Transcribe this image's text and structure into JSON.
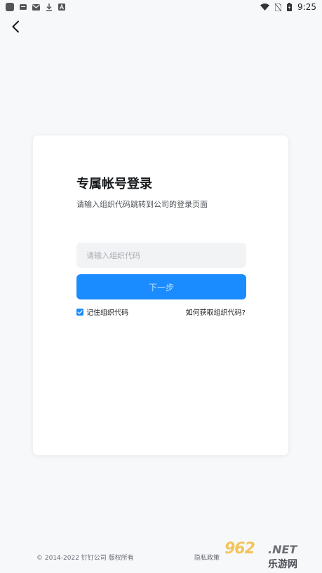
{
  "status_bar": {
    "time": "9:25"
  },
  "login": {
    "title": "专属帐号登录",
    "subtitle": "请输入组织代码跳转到公司的登录页面",
    "org_code_placeholder": "请输入组织代码",
    "org_code_value": "",
    "next_label": "下一步",
    "remember_label": "记住组织代码",
    "remember_checked": true,
    "how_to_label": "如何获取组织代码?"
  },
  "footer": {
    "copyright": "© 2014-2022 钉钉公司 版权所有",
    "privacy_label": "隐私政策"
  },
  "watermark": {
    "number": "962",
    "domain": ".NET",
    "name": "乐游网"
  },
  "colors": {
    "accent": "#1a8cff",
    "background": "#f7f8fa",
    "card": "#ffffff",
    "input_bg": "#f2f3f5"
  }
}
